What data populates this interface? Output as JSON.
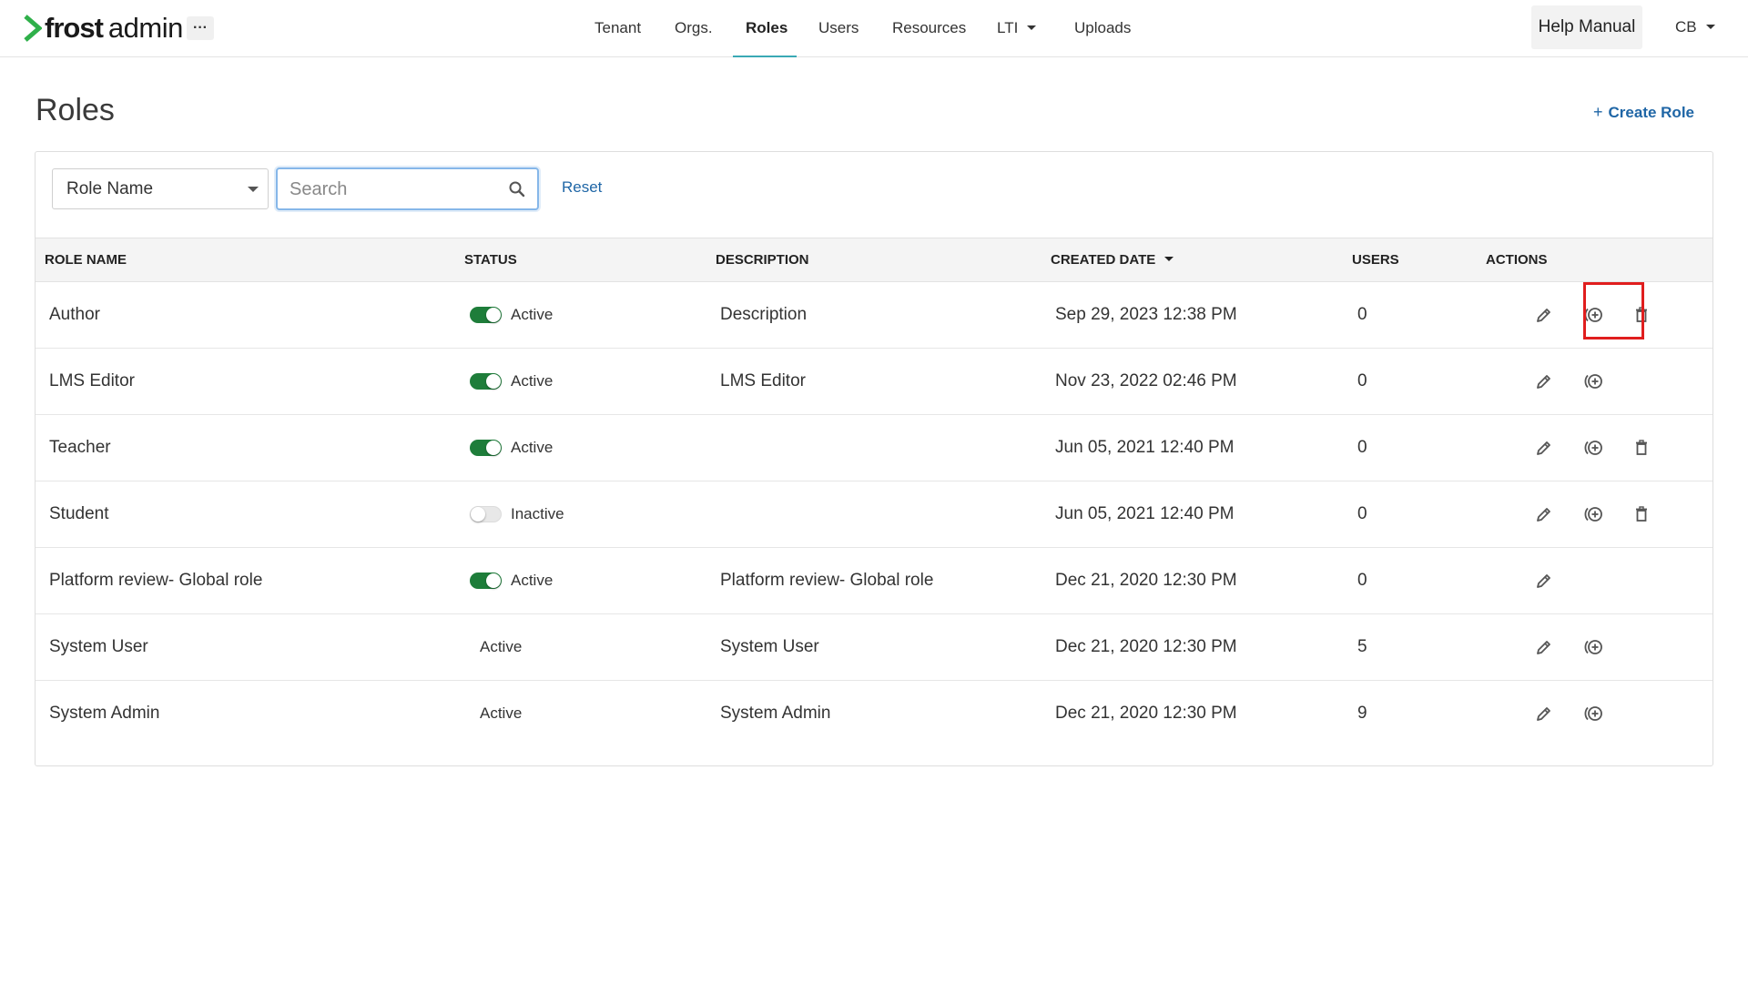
{
  "brand": {
    "name_bold": "frost",
    "name_light": "admin",
    "accent": "#2fb04a"
  },
  "nav": {
    "more_label": "···",
    "items": [
      {
        "label": "Tenant"
      },
      {
        "label": "Orgs."
      },
      {
        "label": "Roles",
        "active": true
      },
      {
        "label": "Users"
      },
      {
        "label": "Resources"
      },
      {
        "label": "LTI",
        "has_caret": true
      },
      {
        "label": "Uploads"
      }
    ],
    "help_label": "Help Manual",
    "user_initials": "CB"
  },
  "page": {
    "title": "Roles",
    "create_label": "Create Role",
    "create_icon": "plus"
  },
  "filters": {
    "field_select": "Role Name",
    "search_placeholder": "Search",
    "search_value": "",
    "reset_label": "Reset"
  },
  "table": {
    "columns": [
      "ROLE NAME",
      "STATUS",
      "DESCRIPTION",
      "CREATED DATE",
      "USERS",
      "ACTIONS"
    ],
    "sorted_column": "CREATED DATE",
    "rows": [
      {
        "name": "Author",
        "status": "Active",
        "toggle": "on",
        "description": "Description",
        "created": "Sep 29, 2023 12:38 PM",
        "users": "0",
        "actions": [
          "edit",
          "permissions",
          "delete"
        ]
      },
      {
        "name": "LMS Editor",
        "status": "Active",
        "toggle": "on",
        "description": "LMS Editor",
        "created": "Nov 23, 2022 02:46 PM",
        "users": "0",
        "actions": [
          "edit",
          "permissions"
        ]
      },
      {
        "name": "Teacher",
        "status": "Active",
        "toggle": "on",
        "description": "",
        "created": "Jun 05, 2021 12:40 PM",
        "users": "0",
        "actions": [
          "edit",
          "permissions",
          "delete"
        ]
      },
      {
        "name": "Student",
        "status": "Inactive",
        "toggle": "off",
        "description": "",
        "created": "Jun 05, 2021 12:40 PM",
        "users": "0",
        "actions": [
          "edit",
          "permissions",
          "delete"
        ]
      },
      {
        "name": "Platform review- Global role",
        "status": "Active",
        "toggle": "on",
        "description": "Platform review- Global role",
        "created": "Dec 21, 2020 12:30 PM",
        "users": "0",
        "actions": [
          "edit"
        ]
      },
      {
        "name": "System User",
        "status": "Active",
        "toggle": "none",
        "description": "System User",
        "created": "Dec 21, 2020 12:30 PM",
        "users": "5",
        "actions": [
          "edit",
          "permissions"
        ]
      },
      {
        "name": "System Admin",
        "status": "Active",
        "toggle": "none",
        "description": "System Admin",
        "created": "Dec 21, 2020 12:30 PM",
        "users": "9",
        "actions": [
          "edit",
          "permissions"
        ]
      }
    ]
  },
  "colors": {
    "link": "#1f66a6",
    "toggle_on": "#1e7d3a",
    "nav_active_underline": "#3aa9b5",
    "highlight": "#e01e1e"
  }
}
